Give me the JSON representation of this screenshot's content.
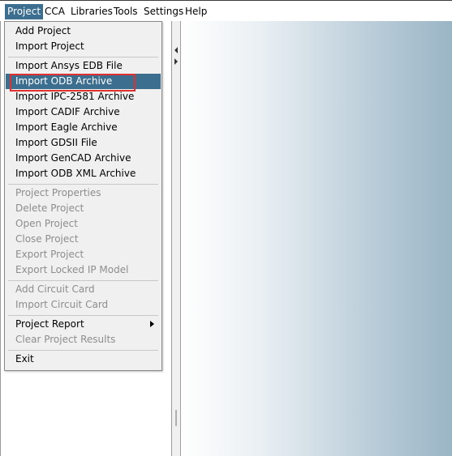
{
  "menubar": {
    "items": [
      {
        "label": "Project"
      },
      {
        "label": "CCA"
      },
      {
        "label": "Libraries"
      },
      {
        "label": "Tools"
      },
      {
        "label": "Settings"
      },
      {
        "label": "Help"
      }
    ]
  },
  "project_menu": {
    "add_project": "Add Project",
    "import_project": "Import Project",
    "import_ansys_edb": "Import Ansys EDB File",
    "import_odb_archive": "Import ODB Archive",
    "import_ipc_2581": "Import IPC-2581 Archive",
    "import_cadif": "Import CADIF Archive",
    "import_eagle": "Import Eagle Archive",
    "import_gdsii": "Import GDSII File",
    "import_gencad": "Import GenCAD Archive",
    "import_odb_xml": "Import ODB XML Archive",
    "project_properties": "Project Properties",
    "delete_project": "Delete Project",
    "open_project": "Open Project",
    "close_project": "Close Project",
    "export_project": "Export Project",
    "export_locked_ip": "Export Locked IP Model",
    "add_circuit_card": "Add Circuit Card",
    "import_circuit_card": "Import Circuit Card",
    "project_report": "Project Report",
    "clear_project_results": "Clear Project Results",
    "exit": "Exit"
  },
  "colors": {
    "highlight": "#3c6e8f",
    "outline": "#e03030",
    "disabled_text": "#8d8d8d"
  }
}
